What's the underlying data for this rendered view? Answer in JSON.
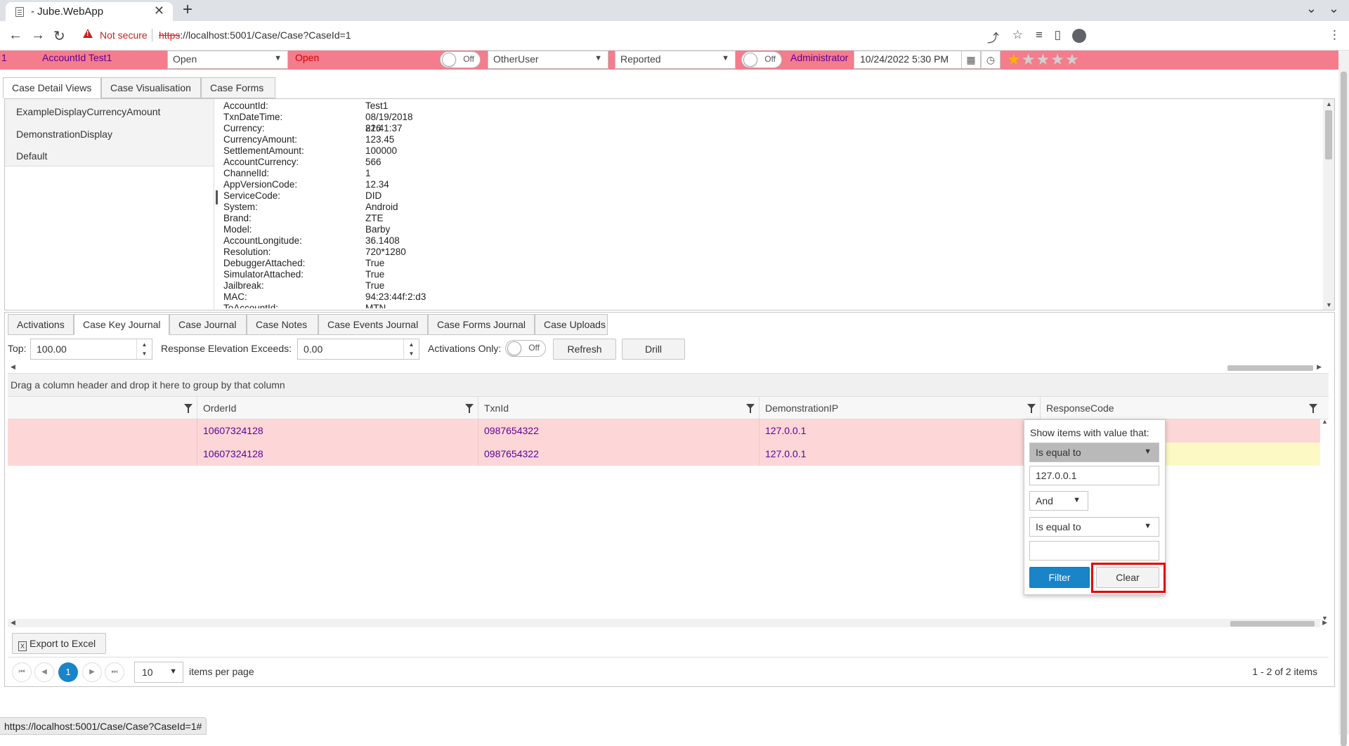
{
  "browser": {
    "tab_title": "- Jube.WebApp",
    "tab_close": "✕",
    "new_tab": "+",
    "tab_menu": "⌄",
    "window_min": "⌄",
    "security_label": "Not secure",
    "url_scheme": "https",
    "url_rest": "://localhost:5001/Case/Case?CaseId=1",
    "status_url": "https://localhost:5001/Case/Case?CaseId=1#"
  },
  "case_header": {
    "case_id": "1",
    "account": "AccountId  Test1",
    "status_select": "Open",
    "status_text": "Open",
    "toggle1": "Off",
    "user_select": "OtherUser",
    "state_select": "Reported",
    "toggle2": "Off",
    "owner": "Administrator",
    "datetime": "10/24/2022 5:30 PM",
    "rating_filled": 1,
    "rating_total": 5,
    "star": "★"
  },
  "top_tabs": [
    "Case Detail Views",
    "Case Visualisation",
    "Case Forms"
  ],
  "views": [
    "ExampleDisplayCurrencyAmount",
    "DemonstrationDisplay",
    "Default"
  ],
  "fields": [
    {
      "k": "AccountId:",
      "v": "Test1"
    },
    {
      "k": "TxnDateTime:",
      "v": "08/19/2018 21:41:37"
    },
    {
      "k": "Currency:",
      "v": "826"
    },
    {
      "k": "CurrencyAmount:",
      "v": "123.45"
    },
    {
      "k": "SettlementAmount:",
      "v": "100000"
    },
    {
      "k": "AccountCurrency:",
      "v": "566"
    },
    {
      "k": "ChannelId:",
      "v": "1"
    },
    {
      "k": "AppVersionCode:",
      "v": "12.34"
    },
    {
      "k": "ServiceCode:",
      "v": "DID"
    },
    {
      "k": "System:",
      "v": "Android"
    },
    {
      "k": "Brand:",
      "v": "ZTE"
    },
    {
      "k": "Model:",
      "v": "Barby"
    },
    {
      "k": "AccountLongitude:",
      "v": "36.1408"
    },
    {
      "k": "Resolution:",
      "v": "720*1280"
    },
    {
      "k": "DebuggerAttached:",
      "v": "True"
    },
    {
      "k": "SimulatorAttached:",
      "v": "True"
    },
    {
      "k": "Jailbreak:",
      "v": "True"
    },
    {
      "k": "MAC:",
      "v": "94:23:44f:2:d3"
    },
    {
      "k": "ToAccountId:",
      "v": "MTN"
    }
  ],
  "bottom_tabs": [
    "Activations",
    "Case Key Journal",
    "Case Journal",
    "Case Notes",
    "Case Events Journal",
    "Case Forms Journal",
    "Case Uploads"
  ],
  "toolbar": {
    "top_label": "Top:",
    "top_value": "100.00",
    "elev_label": "Response Elevation Exceeds:",
    "elev_value": "0.00",
    "act_label": "Activations Only:",
    "act_toggle": "Off",
    "refresh": "Refresh",
    "drill": "Drill"
  },
  "grid": {
    "group_hint": "Drag a column header and drop it here to group by that column",
    "columns": [
      "",
      "OrderId",
      "TxnId",
      "DemonstrationIP",
      "ResponseCode"
    ],
    "rows": [
      {
        "order": "10607324128",
        "txn": "0987654322",
        "ip": "127.0.0.1",
        "color": "#fdd7d7"
      },
      {
        "order": "10607324128",
        "txn": "0987654322",
        "ip": "127.0.0.1",
        "color": "#fdd7d7"
      }
    ],
    "export": "Export to Excel",
    "export_icon": "X"
  },
  "pager": {
    "current": "1",
    "page_size": "10",
    "per_page": "items per page",
    "info": "1 - 2 of 2 items",
    "first": "⏮",
    "prev": "◀",
    "next": "▶",
    "last": "⏭"
  },
  "filter_popup": {
    "title": "Show items with value that:",
    "op1": "Is equal to",
    "value1": "127.0.0.1",
    "logic": "And",
    "op2": "Is equal to",
    "value2": "",
    "filter_btn": "Filter",
    "clear_btn": "Clear"
  },
  "colors": {
    "header_strip": "#f47c8c",
    "accent_blue": "#1984c8",
    "row_pink": "#fdd7d7",
    "row_yellow": "#fdf9c4"
  }
}
